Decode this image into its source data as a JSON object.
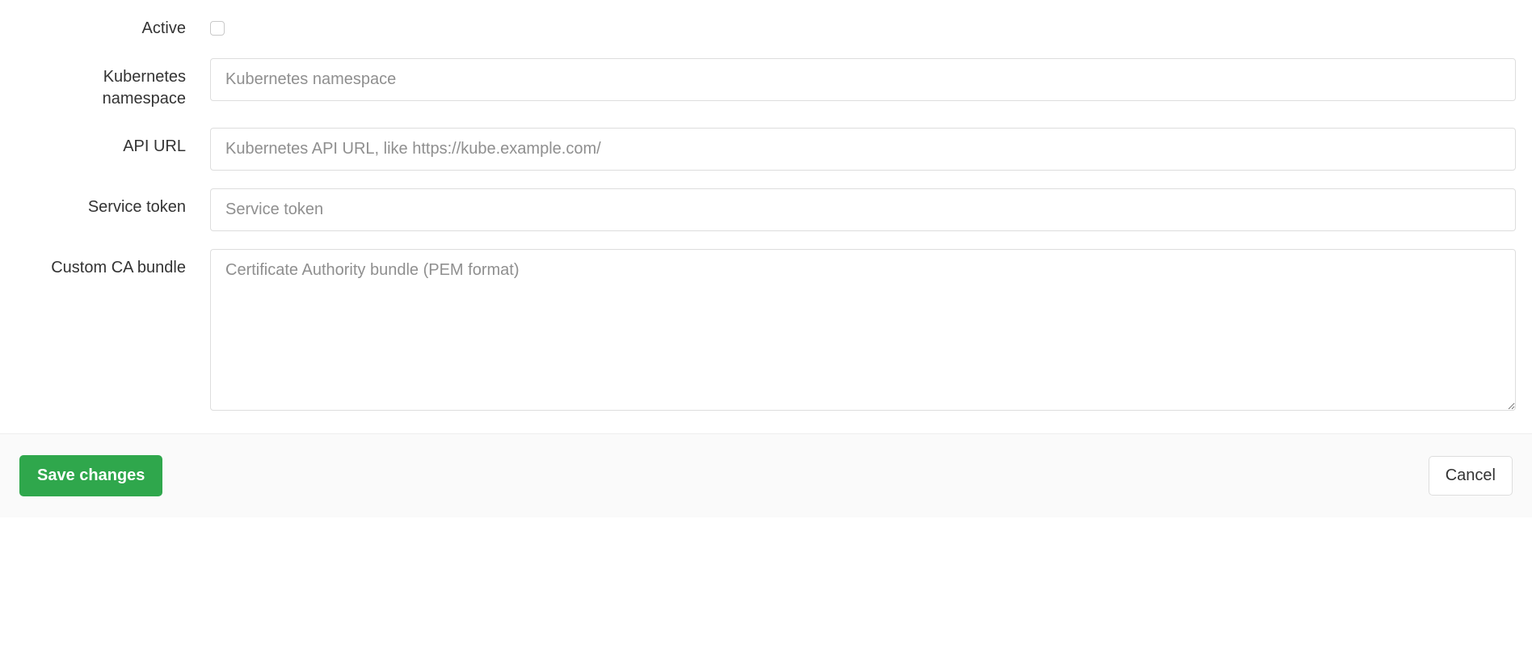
{
  "fields": {
    "active": {
      "label": "Active",
      "checked": false
    },
    "namespace": {
      "label": "Kubernetes namespace",
      "placeholder": "Kubernetes namespace",
      "value": ""
    },
    "api_url": {
      "label": "API URL",
      "placeholder": "Kubernetes API URL, like https://kube.example.com/",
      "value": ""
    },
    "service_token": {
      "label": "Service token",
      "placeholder": "Service token",
      "value": ""
    },
    "ca_bundle": {
      "label": "Custom CA bundle",
      "placeholder": "Certificate Authority bundle (PEM format)",
      "value": ""
    }
  },
  "actions": {
    "save": "Save changes",
    "cancel": "Cancel"
  }
}
